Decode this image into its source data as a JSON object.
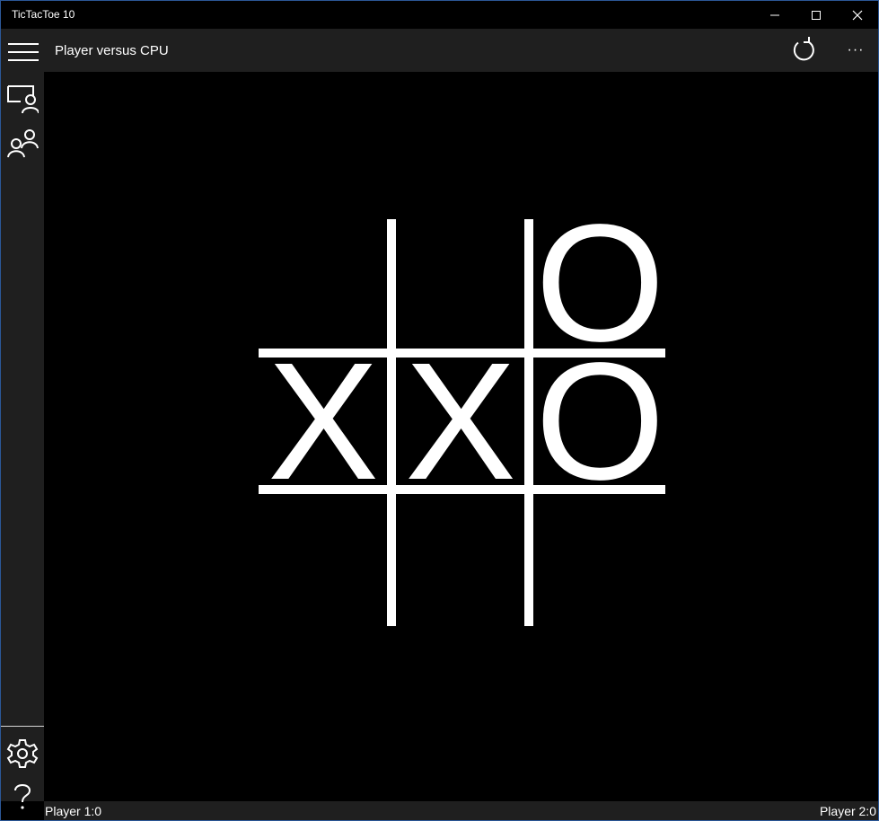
{
  "window": {
    "title": "TicTacToe 10",
    "accent_color": "#2b5797",
    "controls": [
      "minimize-icon",
      "maximize-icon",
      "close-icon"
    ]
  },
  "header": {
    "title": "Player versus CPU",
    "refresh_icon": "refresh-icon",
    "more_label": "···"
  },
  "rail": {
    "items": [
      {
        "icon": "hamburger-menu-icon"
      },
      {
        "icon": "player-vs-cpu-icon"
      },
      {
        "icon": "player-vs-player-icon"
      }
    ],
    "bottom_items": [
      {
        "icon": "settings-gear-icon"
      },
      {
        "icon": "help-icon"
      }
    ]
  },
  "board": {
    "cells": [
      "",
      "",
      "O",
      "X",
      "X",
      "O",
      "",
      "",
      ""
    ]
  },
  "status": {
    "player1": "Player 1:0",
    "player2": "Player 2:0"
  }
}
